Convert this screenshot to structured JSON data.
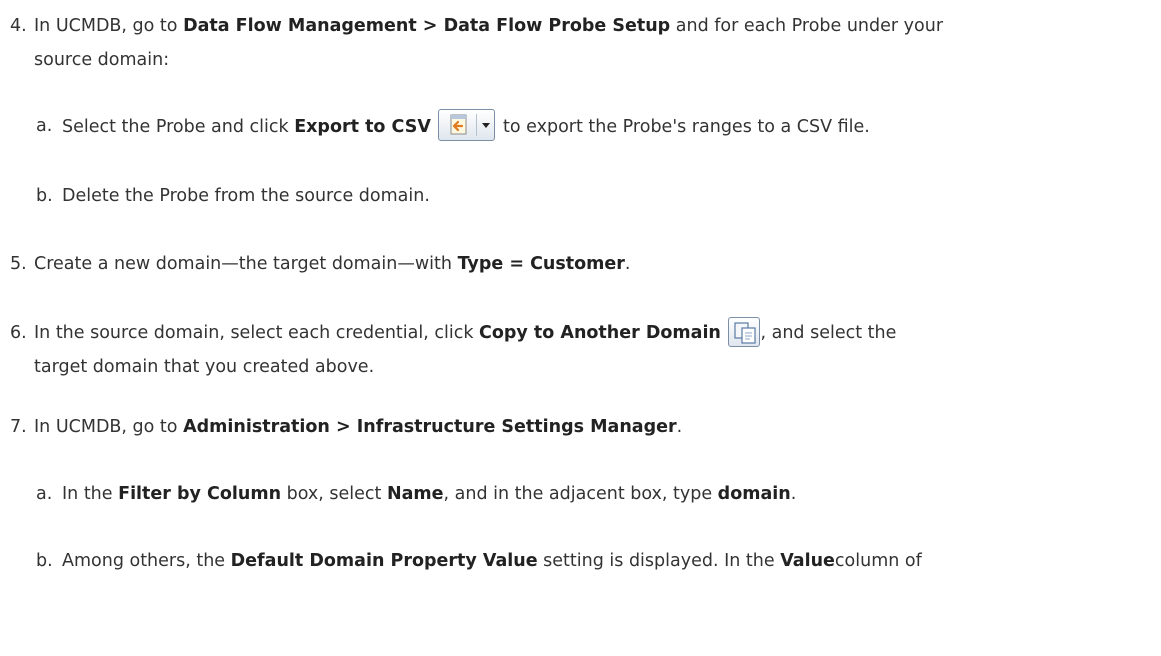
{
  "steps": [
    {
      "num": "4.",
      "l1a": "In UCMDB, go to ",
      "b1": "Data Flow Management > Data Flow Probe Setup",
      "l1b": " and for each Probe under your",
      "l2": "source domain:"
    },
    {
      "num": "a.",
      "t1": "Select the Probe and click ",
      "b1": "Export to CSV",
      "t2": " to export the Probe's ranges to a CSV file."
    },
    {
      "num": "b.",
      "t1": "Delete the Probe from the source domain."
    },
    {
      "num": "5.",
      "t1": "Create a new domain—the target domain—with ",
      "b1": "Type = Customer",
      "t2": "."
    },
    {
      "num": "6.",
      "t1": "In the source domain, select each credential, click ",
      "b1": "Copy to Another Domain",
      "t2": ", and select the",
      "l2": "target domain that you created above."
    },
    {
      "num": "7.",
      "t1": "In UCMDB, go to ",
      "b1": "Administration > Infrastructure Settings Manager",
      "t2": "."
    },
    {
      "num": "a.",
      "t1": "In the ",
      "b1": "Filter by Column",
      "t2": " box, select ",
      "b2": "Name",
      "t3": ", and in the adjacent box, type ",
      "b3": "domain",
      "t4": "."
    },
    {
      "num": "b.",
      "t1": "Among others, the ",
      "b1": "Default Domain Property Value",
      "t2": " setting is displayed. In the ",
      "b2": "Value",
      "t3": "column of"
    }
  ],
  "icons": {
    "export_csv": "export-csv-icon",
    "copy_domain": "copy-to-domain-icon"
  }
}
